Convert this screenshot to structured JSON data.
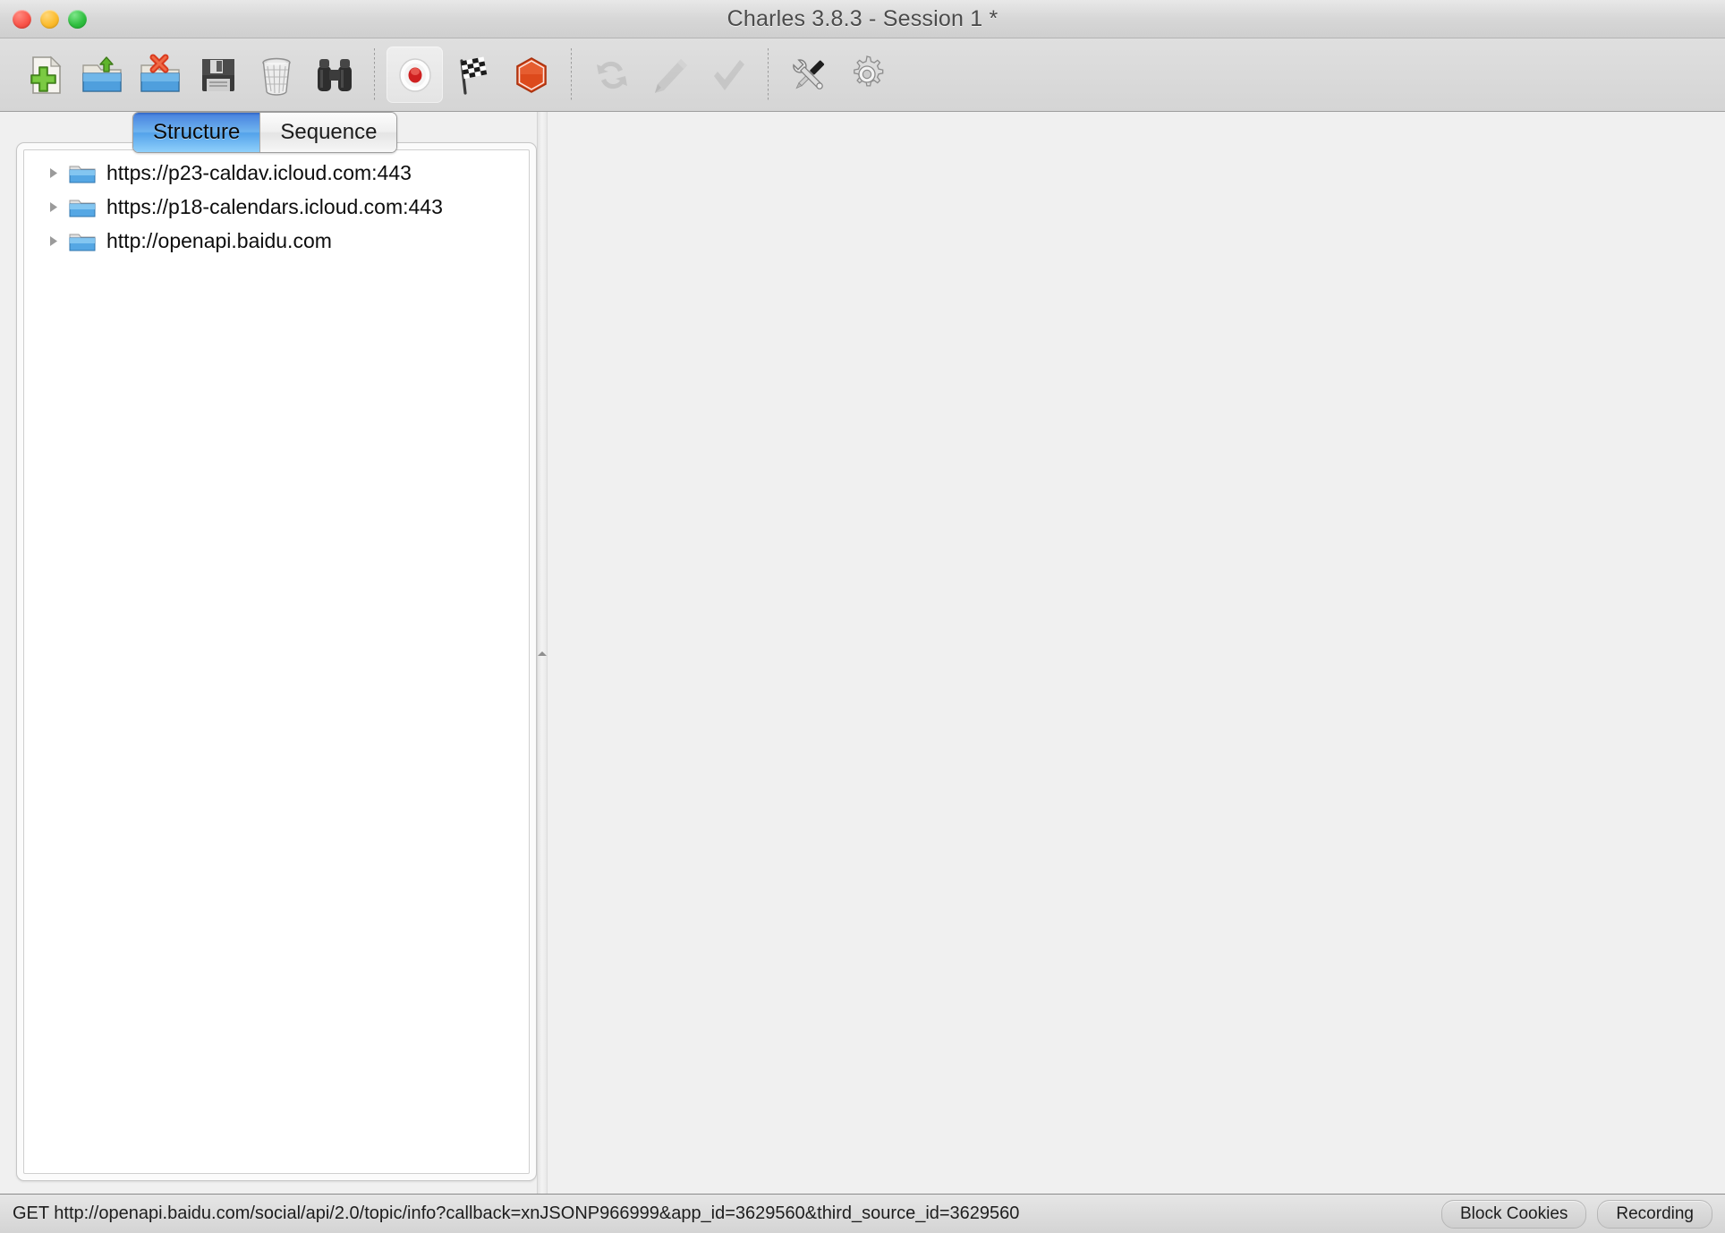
{
  "window": {
    "title": "Charles 3.8.3 - Session 1 *",
    "controls": {
      "close": "close",
      "minimize": "minimize",
      "maximize": "maximize"
    }
  },
  "toolbar": {
    "groups": [
      {
        "buttons": [
          {
            "name": "new-session-button",
            "icon": "new-document-icon",
            "label": "New Session",
            "state": "enabled"
          },
          {
            "name": "open-session-button",
            "icon": "open-folder-icon",
            "label": "Open Session",
            "state": "enabled"
          },
          {
            "name": "close-session-button",
            "icon": "close-folder-icon",
            "label": "Close Session",
            "state": "enabled"
          },
          {
            "name": "save-session-button",
            "icon": "floppy-disk-icon",
            "label": "Save Session",
            "state": "enabled"
          },
          {
            "name": "clear-session-button",
            "icon": "trash-can-icon",
            "label": "Clear Session",
            "state": "enabled"
          },
          {
            "name": "find-button",
            "icon": "binoculars-icon",
            "label": "Find",
            "state": "enabled"
          }
        ]
      },
      {
        "buttons": [
          {
            "name": "record-button",
            "icon": "record-icon",
            "label": "Start Recording",
            "state": "active"
          },
          {
            "name": "throttle-button",
            "icon": "checkered-flag-icon",
            "label": "Throttle",
            "state": "enabled"
          },
          {
            "name": "breakpoints-button",
            "icon": "stop-hexagon-icon",
            "label": "Breakpoints",
            "state": "enabled"
          }
        ]
      },
      {
        "buttons": [
          {
            "name": "repeat-button",
            "icon": "repeat-arrow-icon",
            "label": "Repeat",
            "state": "disabled"
          },
          {
            "name": "edit-button",
            "icon": "pencil-icon",
            "label": "Edit",
            "state": "disabled"
          },
          {
            "name": "validate-button",
            "icon": "checkmark-icon",
            "label": "Validate",
            "state": "disabled"
          }
        ]
      },
      {
        "buttons": [
          {
            "name": "tools-button",
            "icon": "tools-icon",
            "label": "Tools",
            "state": "enabled"
          },
          {
            "name": "settings-button",
            "icon": "gear-icon",
            "label": "Settings",
            "state": "enabled"
          }
        ]
      }
    ]
  },
  "tabs": [
    {
      "label": "Structure",
      "selected": true
    },
    {
      "label": "Sequence",
      "selected": false
    }
  ],
  "tree": {
    "rows": [
      {
        "label": "https://p23-caldav.icloud.com:443",
        "expanded": false,
        "icon": "folder-icon"
      },
      {
        "label": "https://p18-calendars.icloud.com:443",
        "expanded": false,
        "icon": "folder-icon"
      },
      {
        "label": "http://openapi.baidu.com",
        "expanded": false,
        "icon": "folder-icon"
      }
    ]
  },
  "splitter": {
    "handle_icon": "collapse-chevron-icon"
  },
  "detail_pane": {
    "content": ""
  },
  "statusbar": {
    "message": "GET http://openapi.baidu.com/social/api/2.0/topic/info?callback=xnJSONP966999&app_id=3629560&third_source_id=3629560",
    "pills": [
      {
        "name": "block-cookies-status",
        "label": "Block Cookies"
      },
      {
        "name": "recording-status",
        "label": "Recording"
      }
    ]
  },
  "colors": {
    "window_bg": "#f0f0f0",
    "toolbar_bg": "#d9d9d9",
    "tab_selected": "#6fb4ef",
    "folder_blue": "#79b9e8",
    "record_red": "#d62a2a",
    "stop_orange": "#e0522a",
    "tree_bg": "#ffffff"
  }
}
